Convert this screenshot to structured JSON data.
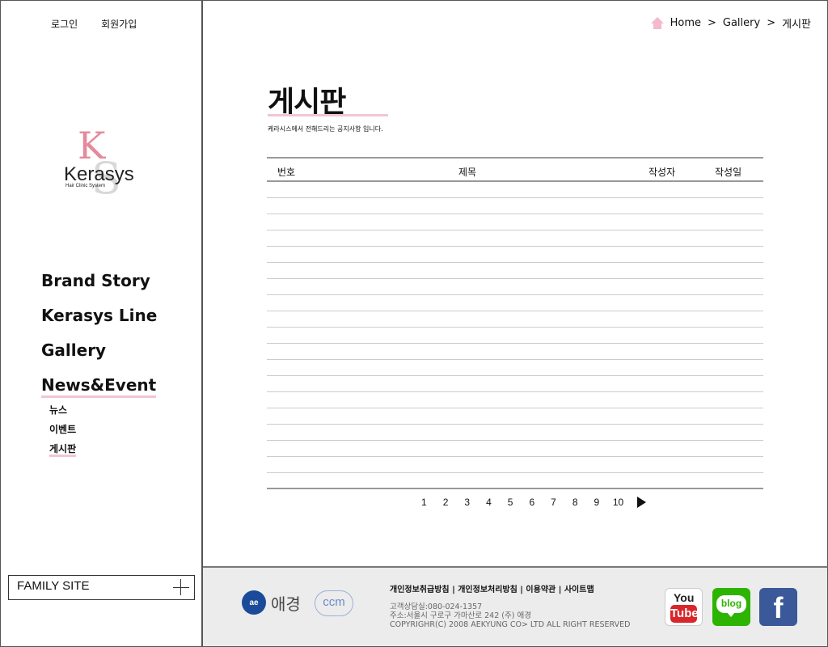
{
  "auth": {
    "login": "로그인",
    "signup": "회원가입"
  },
  "logo": {
    "name": "Kerasys",
    "tagline": "Hair Clinic System"
  },
  "nav": {
    "items": [
      {
        "label": "Brand Story"
      },
      {
        "label": "Kerasys Line"
      },
      {
        "label": "Gallery"
      },
      {
        "label": "News&Event"
      }
    ],
    "sub": [
      {
        "label": "뉴스"
      },
      {
        "label": "이벤트"
      },
      {
        "label": "게시판"
      }
    ]
  },
  "family_site": "FAMILY SITE",
  "breadcrumb": {
    "home": "Home",
    "sep": ">",
    "level1": "Gallery",
    "level2": "게시판"
  },
  "page": {
    "title": "게시판",
    "subtitle": "케라시스에서 전해드리는 공지사항 입니다."
  },
  "board": {
    "columns": [
      "번호",
      "제목",
      "작성자",
      "작성일"
    ],
    "row_count": 19
  },
  "pagination": {
    "pages": [
      "1",
      "2",
      "3",
      "4",
      "5",
      "6",
      "7",
      "8",
      "9",
      "10"
    ]
  },
  "footer": {
    "brand": "애경",
    "ac": "ae",
    "ccm": "ccm",
    "links": "개인정보취급방침 | 개인정보처리방침 | 이용약관 | 사이트맵",
    "phone": "고객상담실:080-024-1357",
    "address": "주소:서울시 구로구 가마산로 242 (주) 애경",
    "copyright": "COPYRIGHR(C) 2008 AEKYUNG CO> LTD ALL RIGHT RESERVED",
    "youtube_top": "You",
    "youtube_bottom": "Tube",
    "blog": "blog",
    "facebook": "f"
  }
}
